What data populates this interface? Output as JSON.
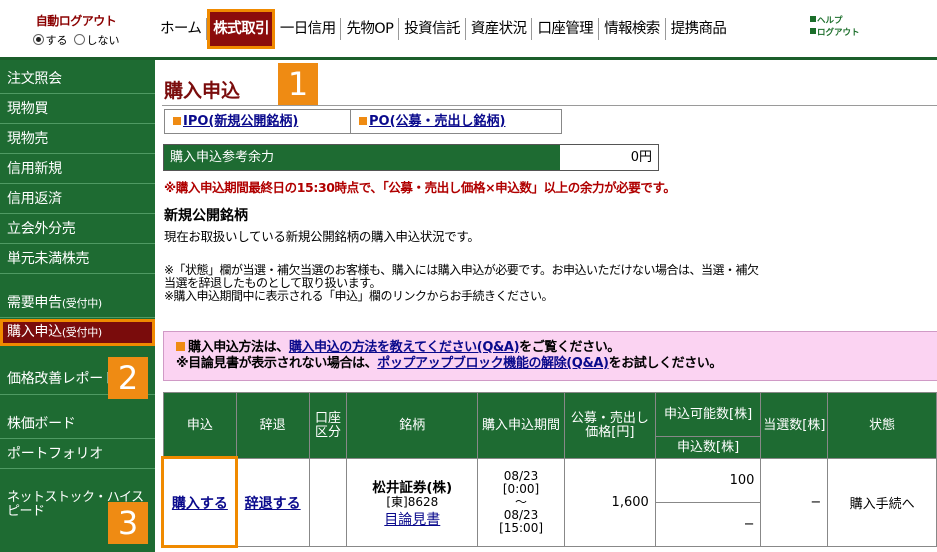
{
  "header": {
    "auto_logout": {
      "title": "自動ログアウト",
      "options": [
        "する",
        "しない"
      ],
      "selected": "する"
    },
    "nav": [
      "ホーム",
      "株式取引",
      "一日信用",
      "先物OP",
      "投資信託",
      "資産状況",
      "口座管理",
      "情報検索",
      "提携商品"
    ],
    "active_nav": "株式取引",
    "help_links": [
      "ヘルプ",
      "ログアウト"
    ]
  },
  "sidebar": {
    "items": [
      {
        "label": "注文照会"
      },
      {
        "label": "現物買"
      },
      {
        "label": "現物売"
      },
      {
        "label": "信用新規"
      },
      {
        "label": "信用返済"
      },
      {
        "label": "立会外分売"
      },
      {
        "label": "単元未満株売"
      },
      {
        "label": "需要申告",
        "sub": "(受付中)"
      },
      {
        "label": "購入申込",
        "sub": "(受付中)"
      },
      {
        "label": "価格改善レポート"
      },
      {
        "label": "株価ボード"
      },
      {
        "label": "ポートフォリオ"
      },
      {
        "label": "ネットストック・ハイスピード"
      }
    ],
    "active_item": "購入申込"
  },
  "callouts": [
    "1",
    "2",
    "3"
  ],
  "page": {
    "title": "購入申込",
    "tabs": [
      "IPO(新規公開銘柄)",
      "PO(公募・売出し銘柄)"
    ],
    "balance": {
      "label": "購入申込参考余力",
      "value": "0円"
    },
    "warning": "※購入申込期間最終日の15:30時点で、「公募・売出し価格×申込数」以上の余力が必要です。",
    "section_heading": "新規公開銘柄",
    "section_desc": "現在お取扱いしている新規公開銘柄の購入申込状況です。",
    "notes": [
      "※「状態」欄が当選・補欠当選のお客様も、購入には購入申込が必要です。お申込いただけない場合は、当選・補欠",
      "当選を辞退したものとして取り扱います。",
      "※購入申込期間中に表示される「申込」欄のリンクからお手続きください。"
    ],
    "info": {
      "line1_prefix": "購入申込方法は、",
      "line1_link": "購入申込の方法を教えてください(Q&A)",
      "line1_suffix": "をご覧ください。",
      "line2_prefix": "※目論見書が表示されない場合は、",
      "line2_link": "ポップアップブロック機能の解除(Q&A)",
      "line2_suffix": "をお試しください。"
    },
    "table": {
      "headers": {
        "apply": "申込",
        "decline": "辞退",
        "account": "口座区分",
        "issue": "銘柄",
        "period": "購入申込期間",
        "price": "公募・売出し価格[円]",
        "avail": "申込可能数[株]",
        "qty": "申込数[株]",
        "won": "当選数[株]",
        "status": "状態"
      },
      "row": {
        "apply_link": "購入する",
        "decline_link": "辞退する",
        "account": "",
        "issue_name": "松井証券(株)",
        "issue_code": "[東]8628",
        "prospectus": "目論見書",
        "period_start_date": "08/23",
        "period_start_time": "[0:00]",
        "period_sep": "〜",
        "period_end_date": "08/23",
        "period_end_time": "[15:00]",
        "price": "1,600",
        "avail": "100",
        "qty": "−",
        "won": "−",
        "status": "購入手続へ"
      }
    }
  },
  "colors": {
    "green": "#1e6b32",
    "maroon": "#7a0c0c",
    "orange": "#ef8b13",
    "pink": "#fbd3f2",
    "warning_red": "#b00000"
  }
}
